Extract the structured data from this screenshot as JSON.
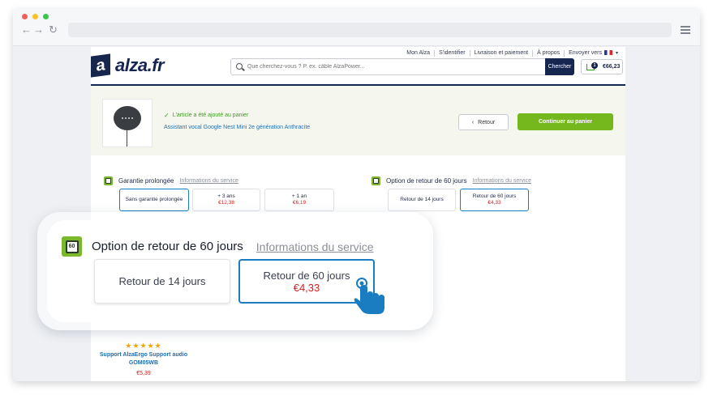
{
  "topnav": {
    "my_account": "Mon Alza",
    "login": "S'identifier",
    "delivery": "Livraison et paiement",
    "about": "À propos",
    "ship_to": "Envoyer vers"
  },
  "logo": {
    "mark": "a",
    "text": "alza.fr"
  },
  "search": {
    "placeholder": "Que cherchez-vous ? P. ex. câble AlzaPower...",
    "button": "Chercher"
  },
  "cart": {
    "total": "€66,23",
    "count": "1"
  },
  "added": {
    "message": "L'article a été ajouté au panier",
    "product_name": "Assistant vocal Google Nest Mini 2e génération Anthracite",
    "back_label": "Retour",
    "continue_label": "Continuer au panier"
  },
  "warranty": {
    "title": "Garantie prolongée",
    "info": "Informations du service",
    "options": [
      {
        "label": "Sans garantie prolongée",
        "price": ""
      },
      {
        "label": "+ 3 ans",
        "price": "€12,38"
      },
      {
        "label": "+ 1 an",
        "price": "€6,19"
      }
    ]
  },
  "returns": {
    "title": "Option de retour de 60 jours",
    "info": "Informations du service",
    "options": [
      {
        "label": "Retour de 14 jours",
        "price": ""
      },
      {
        "label": "Retour de 60 jours",
        "price": "€4,33"
      }
    ]
  },
  "zoom": {
    "icon_text": "60",
    "title": "Option de retour de 60 jours",
    "info": "Informations du service",
    "options": [
      {
        "label": "Retour de 14 jours",
        "price": ""
      },
      {
        "label": "Retour de 60 jours",
        "price": "€4,33"
      }
    ]
  },
  "recommended": {
    "stars": "★★★★★",
    "name": "Support AlzaErgo Support audio GOM05WB",
    "price": "€5,39"
  },
  "colors": {
    "brand_navy": "#17264f",
    "accent_green": "#75b81e",
    "selected_blue": "#1a7cc1",
    "price_red": "#d42020"
  }
}
